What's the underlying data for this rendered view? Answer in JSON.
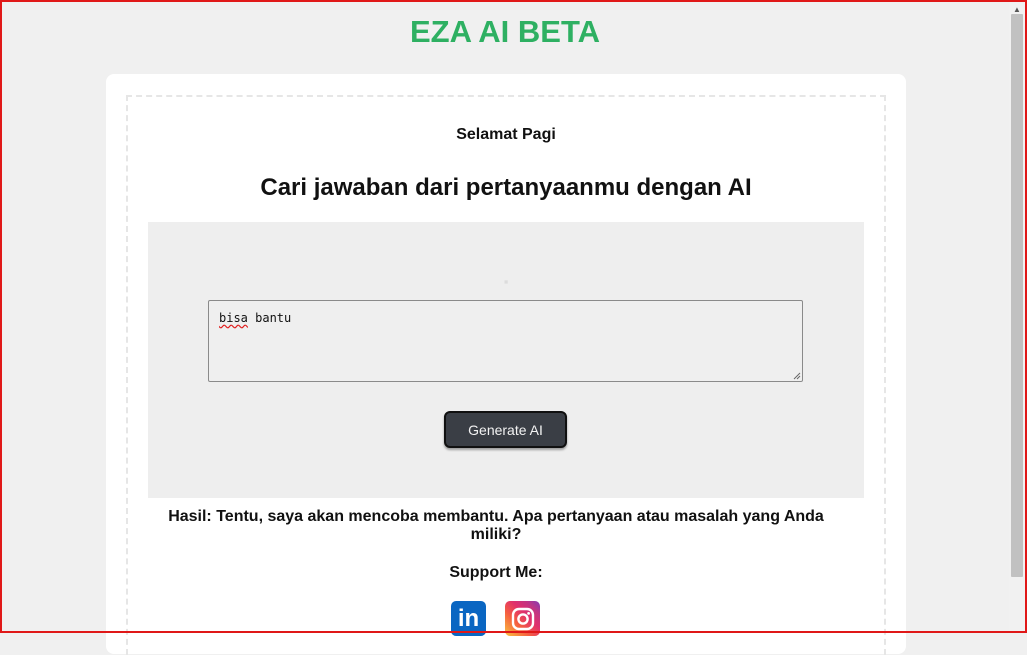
{
  "app": {
    "title": "EZA AI BETA"
  },
  "card": {
    "greeting": "Selamat Pagi",
    "headline": "Cari jawaban dari pertanyaanmu dengan AI"
  },
  "form": {
    "prompt_value_first_word": "bisa",
    "prompt_value_rest": " bantu",
    "generate_label": "Generate AI"
  },
  "result": {
    "label": "Hasil:",
    "text": "Tentu, saya akan mencoba membantu. Apa pertanyaan atau masalah yang Anda miliki?"
  },
  "support": {
    "title": "Support Me:",
    "links": [
      {
        "icon": "linkedin-icon",
        "label": "in",
        "color": "#0a66c2"
      },
      {
        "icon": "instagram-icon",
        "color": "#e1306c"
      }
    ]
  },
  "colors": {
    "accent": "#2eb062",
    "button": "#3a3e45",
    "panel": "#eeeeee"
  }
}
